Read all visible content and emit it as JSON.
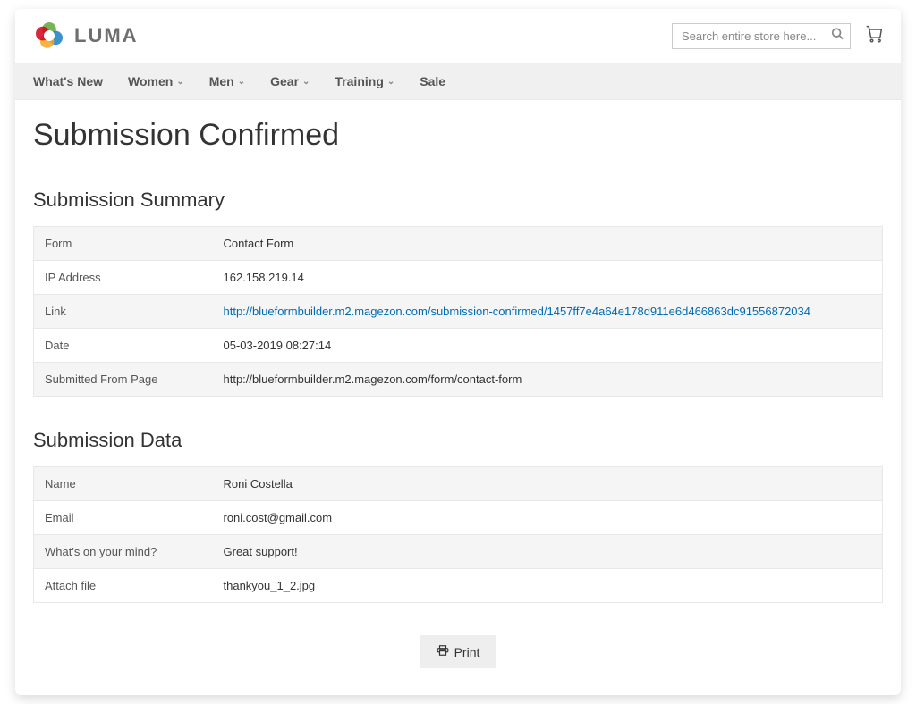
{
  "header": {
    "logo_text": "LUMA",
    "search_placeholder": "Search entire store here..."
  },
  "nav": {
    "items": [
      {
        "label": "What's New",
        "dropdown": false
      },
      {
        "label": "Women",
        "dropdown": true
      },
      {
        "label": "Men",
        "dropdown": true
      },
      {
        "label": "Gear",
        "dropdown": true
      },
      {
        "label": "Training",
        "dropdown": true
      },
      {
        "label": "Sale",
        "dropdown": false
      }
    ]
  },
  "page": {
    "title": "Submission Confirmed"
  },
  "summary": {
    "title": "Submission Summary",
    "rows": [
      {
        "label": "Form",
        "value": "Contact Form",
        "is_link": false
      },
      {
        "label": "IP Address",
        "value": "162.158.219.14",
        "is_link": false
      },
      {
        "label": "Link",
        "value": "http://blueformbuilder.m2.magezon.com/submission-confirmed/1457ff7e4a64e178d911e6d466863dc91556872034",
        "is_link": true
      },
      {
        "label": "Date",
        "value": "05-03-2019 08:27:14",
        "is_link": false
      },
      {
        "label": "Submitted From Page",
        "value": "http://blueformbuilder.m2.magezon.com/form/contact-form",
        "is_link": false
      }
    ]
  },
  "data": {
    "title": "Submission Data",
    "rows": [
      {
        "label": "Name",
        "value": "Roni Costella"
      },
      {
        "label": "Email",
        "value": "roni.cost@gmail.com"
      },
      {
        "label": "What's on your mind?",
        "value": "Great support!"
      },
      {
        "label": "Attach file",
        "value": "thankyou_1_2.jpg"
      }
    ]
  },
  "print_label": "Print"
}
